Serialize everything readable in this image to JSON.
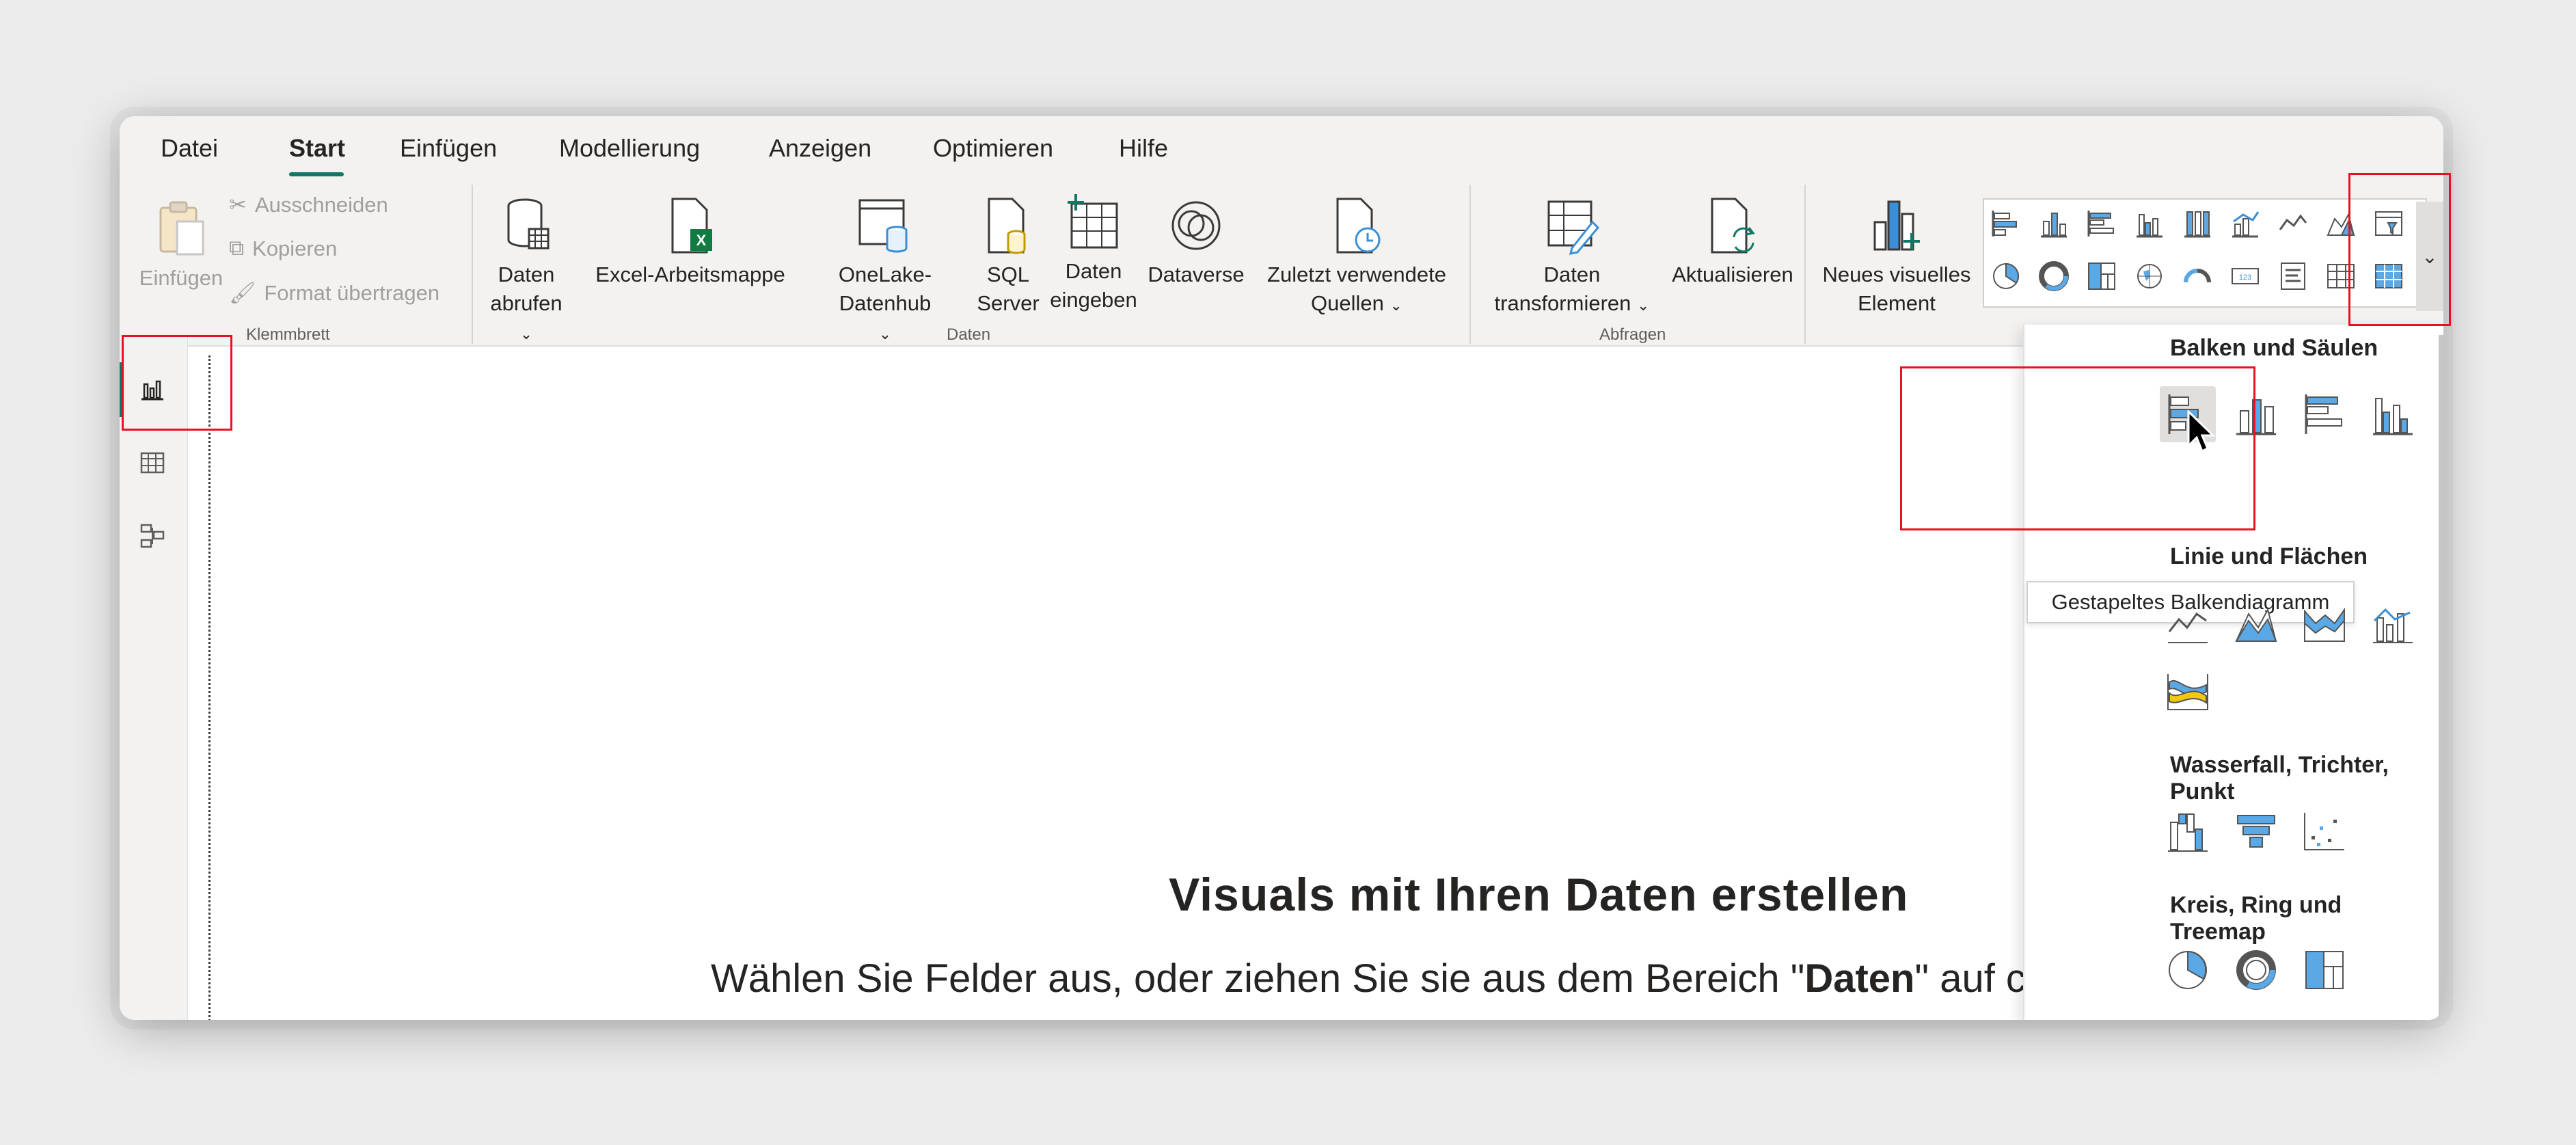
{
  "ribbon": {
    "tabs": [
      "Datei",
      "Start",
      "Einfügen",
      "Modellierung",
      "Anzeigen",
      "Optimieren",
      "Hilfe"
    ],
    "active_tab": "Start",
    "clipboard": {
      "paste": "Einfügen",
      "cut": "Ausschneiden",
      "copy": "Kopieren",
      "format_painter": "Format übertragen",
      "group_label": "Klemmbrett"
    },
    "data": {
      "get_data_1": "Daten",
      "get_data_2": "abrufen",
      "excel": "Excel-Arbeitsmappe",
      "onelake": "OneLake-Datenhub",
      "sql_1": "SQL",
      "sql_2": "Server",
      "enter_1": "Daten",
      "enter_2": "eingeben",
      "dataverse": "Dataverse",
      "recent_1": "Zuletzt verwendete",
      "recent_2": "Quellen",
      "group_label": "Daten"
    },
    "queries": {
      "transform_1": "Daten",
      "transform_2": "transformieren",
      "refresh": "Aktualisieren",
      "group_label": "Abfragen"
    },
    "visuals": {
      "new_visual_1": "Neues visuelles",
      "new_visual_2": "Element"
    }
  },
  "visual_panel": {
    "categories": [
      "Balken und Säulen",
      "Linie und Flächen",
      "Wasserfall, Trichter, Punkt",
      "Kreis, Ring und Treemap"
    ],
    "tooltip": "Gestapeltes Balkendiagramm"
  },
  "canvas": {
    "title": "Visuals mit Ihren Daten erstellen",
    "subtitle_pre": "Wählen Sie Felder aus, oder ziehen Sie sie aus dem Bereich \"",
    "subtitle_bold": "Daten",
    "subtitle_post": "\" auf c"
  },
  "colors": {
    "accent": "#117865",
    "highlight_box": "#e81123",
    "visual_blue": "#5aa9e6"
  }
}
